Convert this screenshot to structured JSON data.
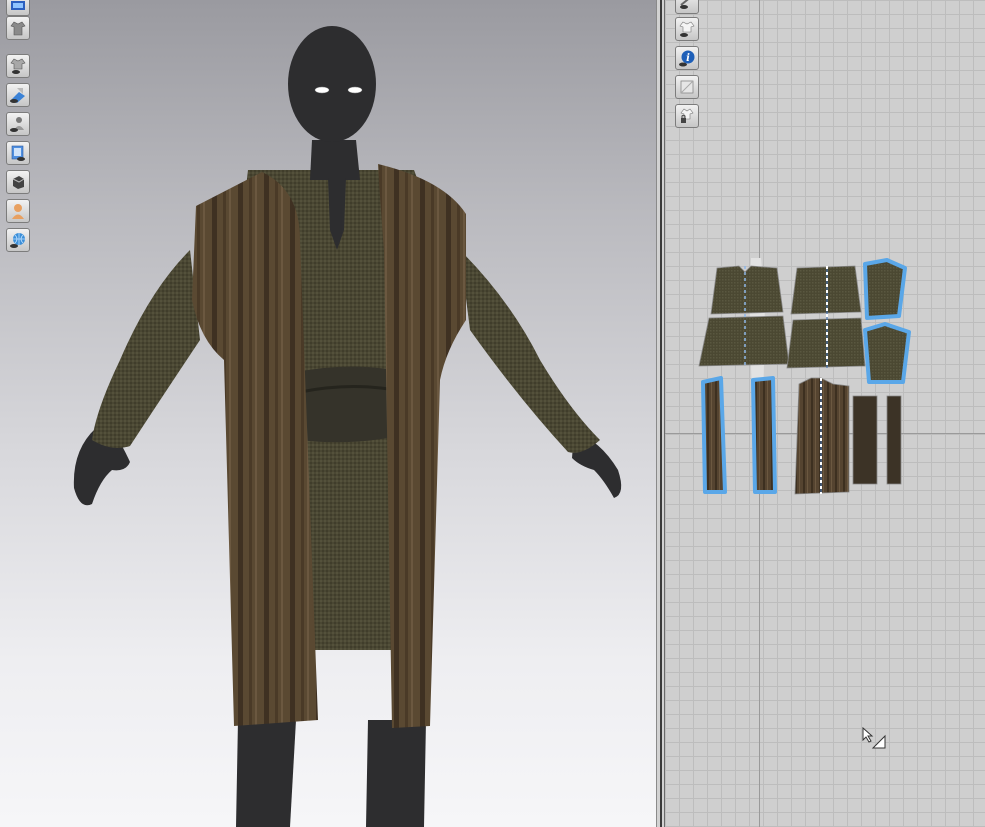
{
  "app": {
    "accent_color": "#5aa7e8",
    "garment_color": "#4a4632",
    "vest_color": "#55442f",
    "avatar_color": "#2e2e30"
  },
  "toolbar3d": {
    "icons": [
      "display-mode-icon",
      "garment-view-icon",
      "show-garment-icon",
      "show-pattern-texture-icon",
      "show-avatar-icon",
      "show-pressure-icon",
      "show-mesh-icon",
      "skin-avatar-icon",
      "environment-globe-icon"
    ]
  },
  "toolbar2d": {
    "icons": [
      "pattern-visibility-icon",
      "show-sewing-icon",
      "pattern-info-icon",
      "pattern-texture-icon",
      "lock-pattern-icon"
    ],
    "info_glyph": "i"
  }
}
